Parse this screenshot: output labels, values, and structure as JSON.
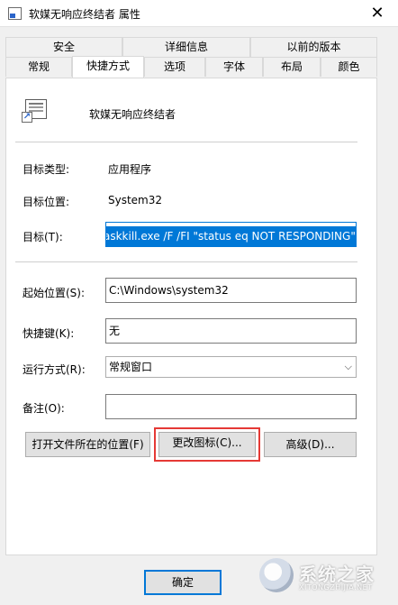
{
  "window": {
    "title": "软媒无响应终结者 属性",
    "close_glyph": "✕"
  },
  "tabs": {
    "row1": [
      "安全",
      "详细信息",
      "以前的版本"
    ],
    "row2": [
      "常规",
      "快捷方式",
      "选项",
      "字体",
      "布局",
      "颜色"
    ],
    "active": "快捷方式"
  },
  "shortcut": {
    "name": "软媒无响应终结者",
    "target_type_label": "目标类型:",
    "target_type_value": "应用程序",
    "target_location_label": "目标位置:",
    "target_location_value": "System32",
    "target_label": "目标(T):",
    "target_value": "askkill.exe /F /FI \"status eq NOT RESPONDING\"",
    "start_in_label": "起始位置(S):",
    "start_in_value": "C:\\Windows\\system32",
    "hotkey_label": "快捷键(K):",
    "hotkey_value": "无",
    "run_label": "运行方式(R):",
    "run_value": "常规窗口",
    "comment_label": "备注(O):",
    "comment_value": ""
  },
  "buttons": {
    "open_location": "打开文件所在的位置(F)",
    "change_icon": "更改图标(C)...",
    "advanced": "高级(D)...",
    "ok": "确定"
  },
  "watermark": {
    "brand": "系统之家",
    "sub": "XITONGZHIJIA.NET"
  },
  "colors": {
    "accent": "#0078d7",
    "highlight": "#e53935"
  }
}
